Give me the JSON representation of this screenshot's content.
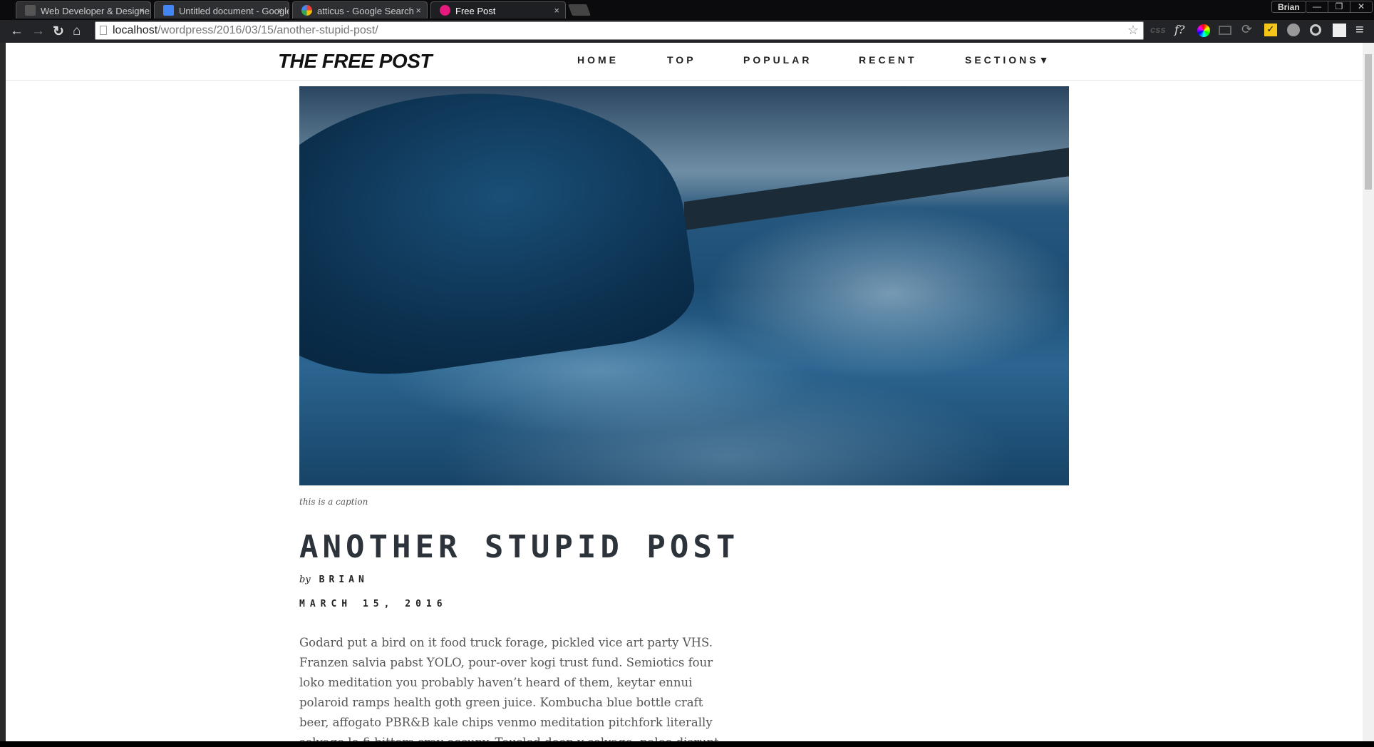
{
  "browser": {
    "tabs": [
      {
        "title": "Web Developer & Designer",
        "active": false
      },
      {
        "title": "Untitled document - Google Docs",
        "active": false
      },
      {
        "title": "atticus - Google Search",
        "active": false
      },
      {
        "title": "Free Post",
        "active": true
      }
    ],
    "close_glyph": "×",
    "user": "Brian",
    "url_host": "localhost",
    "url_path": "/wordpress/2016/03/15/another-stupid-post/",
    "extensions": [
      "css-icon",
      "font-icon",
      "color-picker-icon",
      "cast-icon",
      "sync-icon",
      "norton-icon",
      "privacy-icon",
      "circle-icon",
      "image-icon",
      "menu-icon"
    ],
    "ext_css": "css",
    "ext_font": "f?"
  },
  "site": {
    "logo": "THE FREE POST",
    "nav": [
      "HOME",
      "TOP",
      "POPULAR",
      "RECENT",
      "SECTIONS▼"
    ]
  },
  "post": {
    "caption": "this is a caption",
    "title": "ANOTHER STUPID POST",
    "by": "by",
    "author": "BRIAN",
    "date": "MARCH 15, 2016",
    "body": "Godard put a bird on it food truck forage, pickled vice art party VHS. Franzen salvia pabst YOLO, pour-over kogi trust fund. Semiotics four loko meditation you probably haven’t heard of them, keytar ennui polaroid ramps health goth green juice. Kombucha blue bottle craft beer, affogato PBR&B kale chips venmo meditation pitchfork literally selvage lo-fi bitters cray occupy. Tousled deep v selvage, paleo disrupt lomo next level"
  }
}
